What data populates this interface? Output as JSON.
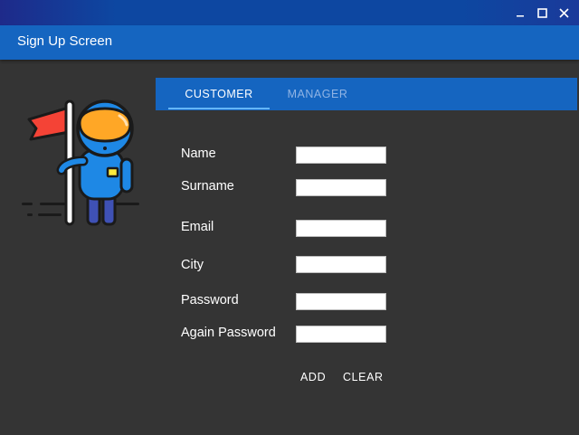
{
  "window": {
    "title": "Sign Up Screen",
    "controls": {
      "minimize_icon": "minimize-icon",
      "maximize_icon": "maximize-icon",
      "close_icon": "close-icon"
    }
  },
  "illustration": {
    "icon": "astronaut-with-flag-illustration",
    "suit_color": "#1e88e5",
    "visor_color": "#ffa726",
    "flag_color": "#f44336"
  },
  "tabs": [
    {
      "label": "CUSTOMER",
      "active": true
    },
    {
      "label": "MANAGER",
      "active": false
    }
  ],
  "form": {
    "fields": [
      {
        "label": "Name",
        "value": ""
      },
      {
        "label": "Surname",
        "value": ""
      },
      {
        "label": "Email",
        "value": ""
      },
      {
        "label": "City",
        "value": ""
      },
      {
        "label": "Password",
        "value": ""
      },
      {
        "label": "Again Password",
        "value": ""
      }
    ],
    "buttons": {
      "add": "ADD",
      "clear": "CLEAR"
    }
  },
  "colors": {
    "app_bar": "#1565c0",
    "background": "#343434",
    "tab_indicator": "#64b5f6"
  }
}
